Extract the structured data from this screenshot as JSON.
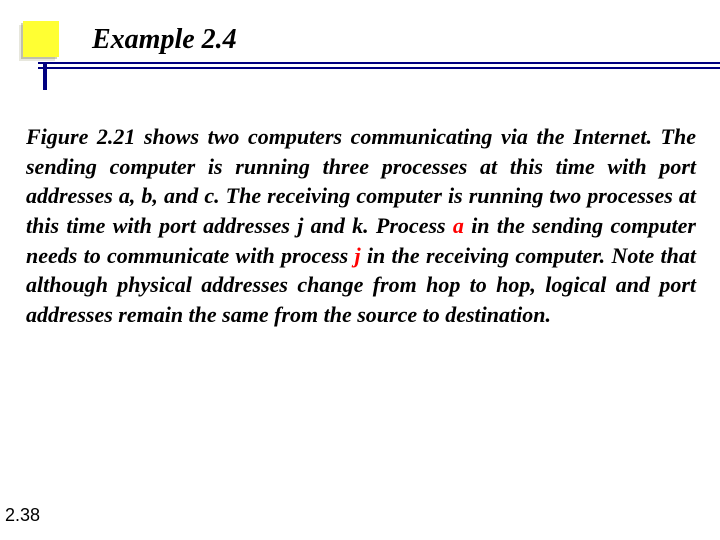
{
  "header": {
    "title": "Example 2.4"
  },
  "body": {
    "p1_a": "Figure 2.21 shows two computers communicating via the Internet. The sending computer is running three processes at this time with port addresses a, b, and c. The receiving computer is running two processes at this time with port addresses j and k. Process ",
    "em_a": "a",
    "p1_b": " in the sending computer needs to communicate with process ",
    "em_j": "j",
    "p1_c": " in the receiving computer. Note that although physical addresses change from hop to hop, logical and port addresses remain the same from the source to destination."
  },
  "footer": {
    "page_number": "2.38"
  }
}
